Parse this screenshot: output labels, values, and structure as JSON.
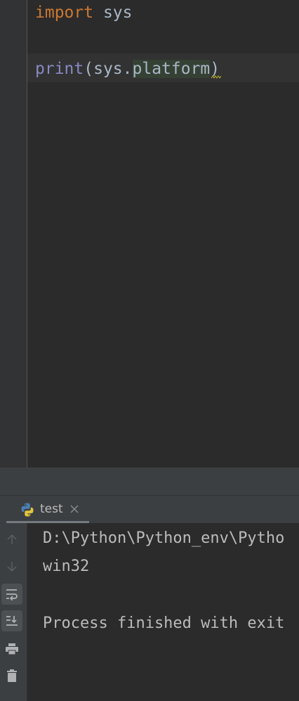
{
  "editor": {
    "lines": [
      {
        "keyword": "import",
        "rest": " sys"
      },
      {
        "func": "print",
        "open": "(sys.",
        "highlighted": "platform",
        "close": ")"
      }
    ]
  },
  "run_panel": {
    "tab_label": "test",
    "tab_icon": "python-icon"
  },
  "console": {
    "lines": [
      "D:\\Python\\Python_env\\Pytho",
      "win32",
      "Process finished with exit"
    ]
  },
  "toolbar": {
    "buttons": [
      {
        "icon": "arrow-up-icon",
        "active": false
      },
      {
        "icon": "arrow-down-icon",
        "active": false
      },
      {
        "icon": "soft-wrap-icon",
        "active": true
      },
      {
        "icon": "scroll-to-end-icon",
        "active": true
      },
      {
        "icon": "print-icon",
        "active": false
      },
      {
        "icon": "trash-icon",
        "active": false
      }
    ]
  },
  "colors": {
    "background": "#2b2b2b",
    "gutter": "#313335",
    "keyword": "#cc7832",
    "builtin": "#8888c6",
    "text": "#a9b7c6",
    "console_text": "#bbbbbb"
  }
}
